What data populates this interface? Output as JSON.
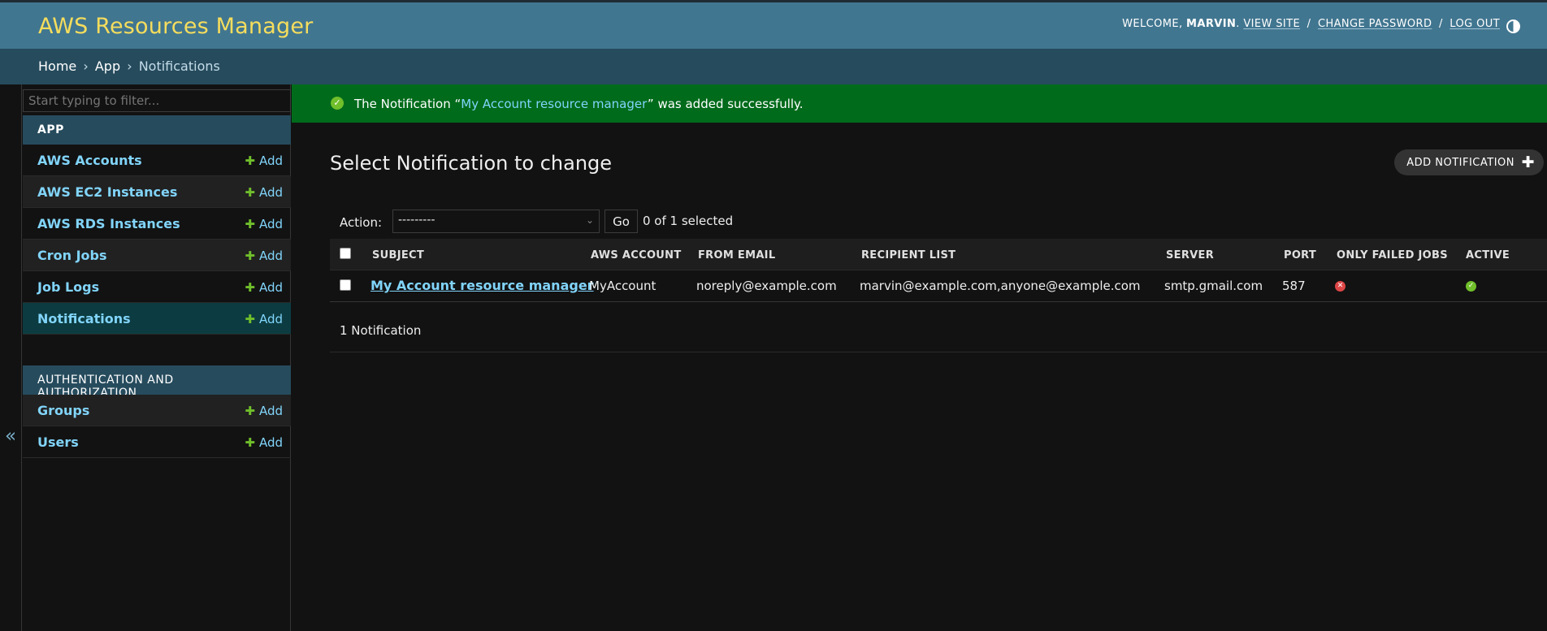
{
  "header": {
    "site_name": "AWS Resources Manager",
    "welcome": "WELCOME,",
    "username": "MARVIN",
    "view_site": "VIEW SITE",
    "change_password": "CHANGE PASSWORD",
    "log_out": "LOG OUT",
    "separator": "/"
  },
  "breadcrumbs": {
    "home": "Home",
    "app": "App",
    "current": "Notifications",
    "arrow": "›"
  },
  "sidebar": {
    "filter_placeholder": "Start typing to filter...",
    "toggle_label": "«",
    "add_label": "Add",
    "modules": [
      {
        "caption": "APP",
        "items": [
          {
            "label": "AWS Accounts"
          },
          {
            "label": "AWS EC2 Instances"
          },
          {
            "label": "AWS RDS Instances"
          },
          {
            "label": "Cron Jobs"
          },
          {
            "label": "Job Logs"
          },
          {
            "label": "Notifications"
          }
        ]
      },
      {
        "caption": "AUTHENTICATION AND AUTHORIZATION",
        "items": [
          {
            "label": "Groups"
          },
          {
            "label": "Users"
          }
        ]
      }
    ]
  },
  "message": {
    "prefix": "The Notification “",
    "link": "My Account resource manager",
    "suffix": "” was added successfully."
  },
  "main": {
    "title": "Select Notification to change",
    "add_button": "ADD NOTIFICATION",
    "action_label": "Action:",
    "action_value": "---------",
    "go_label": "Go",
    "selected_count": "0 of 1 selected",
    "paginator": "1 Notification"
  },
  "table": {
    "headers": [
      "SUBJECT",
      "AWS ACCOUNT",
      "FROM EMAIL",
      "RECIPIENT LIST",
      "SERVER",
      "PORT",
      "ONLY FAILED JOBS",
      "ACTIVE"
    ],
    "rows": [
      {
        "subject": "My Account resource manager",
        "aws_account": "MyAccount",
        "from_email": "noreply@example.com",
        "recipient_list": "marvin@example.com,anyone@example.com",
        "server": "smtp.gmail.com",
        "port": "587",
        "only_failed_jobs": false,
        "active": true
      }
    ]
  },
  "colors": {
    "header_bg": "#417690",
    "branding": "#f5dd5d",
    "breadcrumb_bg": "#264b5d",
    "success_bg": "#006b1b",
    "link": "#81d4fa",
    "add_plus": "#70bf2b",
    "bool_no": "#dd4646",
    "bool_yes": "#70bf2b"
  }
}
